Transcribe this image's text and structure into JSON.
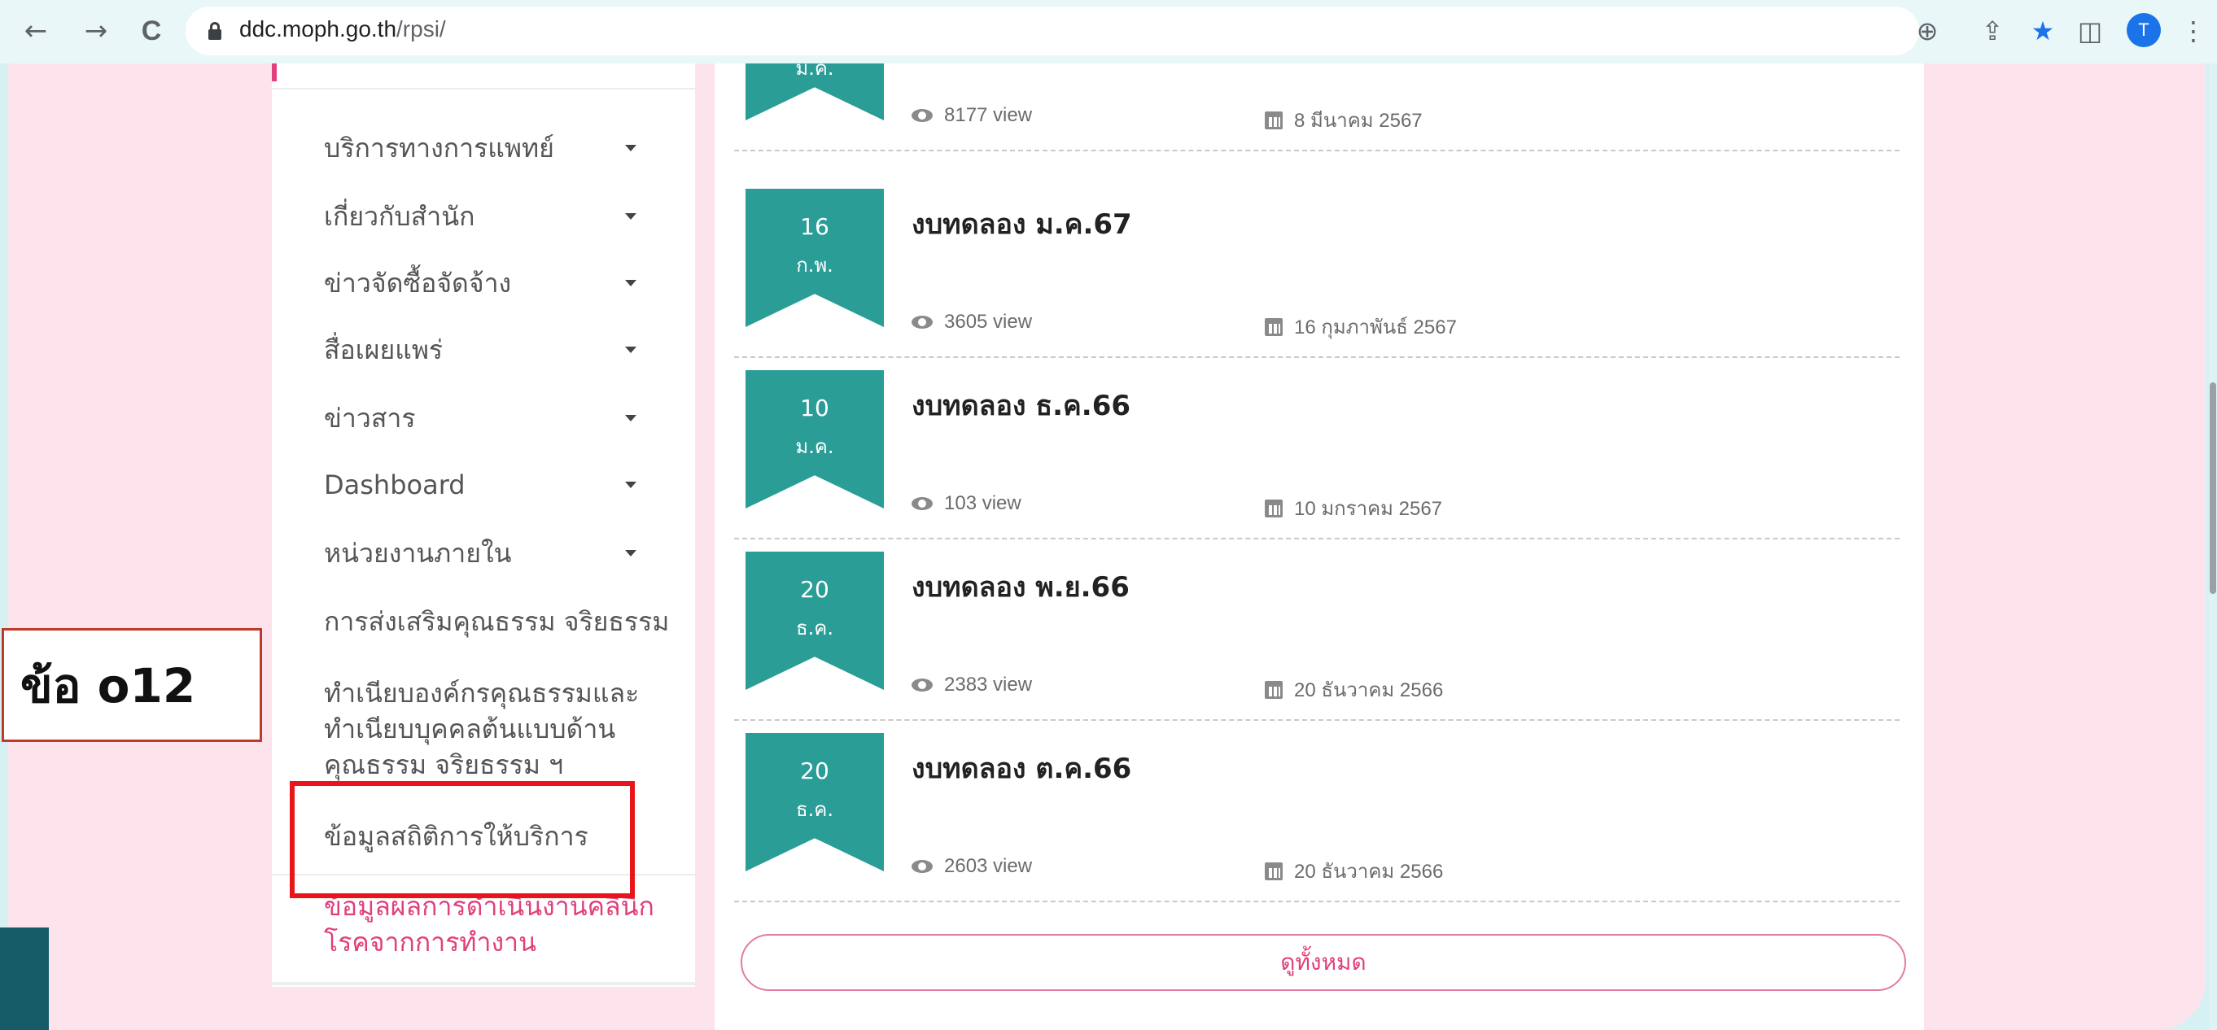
{
  "browser": {
    "back_glyph": "←",
    "forward_glyph": "→",
    "reload_glyph": "C",
    "url_host": "ddc.moph.go.th",
    "url_path": "/rpsi/",
    "zoom_glyph": "⊕",
    "share_glyph": "⇪",
    "star_glyph": "★",
    "sidepanel_glyph": "◫",
    "avatar_letter": "T",
    "menu_glyph": "⋮",
    "colors": {
      "star": "#1a73e8",
      "avatar": "#1a73e8"
    }
  },
  "sidebar": {
    "items": [
      {
        "label": "บริการทางการแพทย์",
        "caret": true
      },
      {
        "label": "เกี่ยวกับสำนัก",
        "caret": true
      },
      {
        "label": "ข่าวจัดซื้อจัดจ้าง",
        "caret": true
      },
      {
        "label": "สื่อเผยแพร่",
        "caret": true
      },
      {
        "label": "ข่าวสาร",
        "caret": true
      },
      {
        "label": "Dashboard",
        "caret": true
      },
      {
        "label": "หน่วยงานภายใน",
        "caret": true
      },
      {
        "label": "การส่งเสริมคุณธรรม จริยธรรม",
        "caret": false
      },
      {
        "label_line1": "ทำเนียบองค์กรคุณธรรมและ",
        "label_line2": "ทำเนียบบุคคลต้นแบบด้าน",
        "label_line3": "คุณธรรม จริยธรรม ฯ"
      },
      {
        "label": "ข้อมูลสถิติการให้บริการ"
      },
      {
        "label_line1": "ข้อมูลผลการดำเนินงานคลินิก",
        "label_line2": "โรคจากการทำงาน"
      }
    ]
  },
  "news": [
    {
      "day": "",
      "month": "มี.ค.",
      "title": "",
      "views": "8177 view",
      "date": "8 มีนาคม 2567"
    },
    {
      "day": "16",
      "month": "ก.พ.",
      "title": "งบทดลอง ม.ค.67",
      "views": "3605 view",
      "date": "16 กุมภาพันธ์ 2567"
    },
    {
      "day": "10",
      "month": "ม.ค.",
      "title": "งบทดลอง ธ.ค.66",
      "views": "103 view",
      "date": "10 มกราคม 2567"
    },
    {
      "day": "20",
      "month": "ธ.ค.",
      "title": "งบทดลอง พ.ย.66",
      "views": "2383 view",
      "date": "20 ธันวาคม 2566"
    },
    {
      "day": "20",
      "month": "ธ.ค.",
      "title": "งบทดลอง ต.ค.66",
      "views": "2603 view",
      "date": "20 ธันวาคม 2566"
    }
  ],
  "view_all_label": "ดูทั้งหมด",
  "annotation": {
    "label": "ข้อ o12",
    "highlight_color": "#e8161b"
  },
  "theme": {
    "ribbon": "#2a9d96",
    "accent_pink": "#e0407c",
    "page_bg": "#fde4ec"
  }
}
